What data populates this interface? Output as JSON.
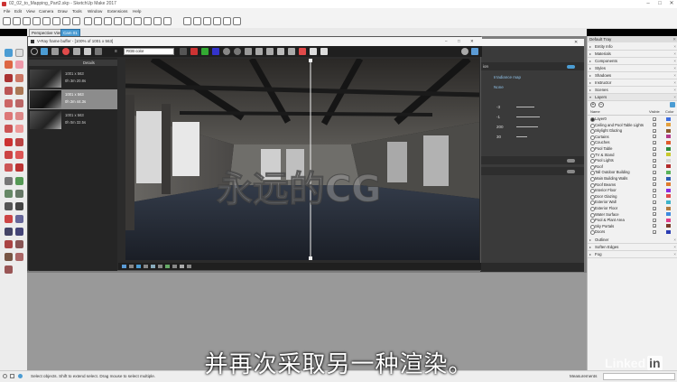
{
  "window": {
    "title": "02_02_to_Mapping_Part2.skp - SketchUp Make 2017",
    "minimize": "–",
    "maximize": "□",
    "close": "✕"
  },
  "menu": [
    "File",
    "Edit",
    "View",
    "Camera",
    "Draw",
    "Tools",
    "Window",
    "Extensions",
    "Help"
  ],
  "scene_tabs": [
    {
      "label": "Perspective View",
      "active": false
    },
    {
      "label": "Cam 01",
      "active": true
    }
  ],
  "frame_buffer": {
    "title": "V-Ray frame buffer - [100% of 1001 x 563]",
    "channel": "RGB color",
    "details_label": "Details",
    "history": [
      {
        "size": "1001 x 563",
        "time": "0h 3m 20.8s",
        "selected": false
      },
      {
        "size": "1001 x 563",
        "time": "0h 2m 44.3s",
        "selected": true
      },
      {
        "size": "1001 x 563",
        "time": "0h 0m 32.5s",
        "selected": false
      }
    ]
  },
  "vray_panel": {
    "section": "ion",
    "gi_primary": "Irradiance map",
    "gi_secondary": "None",
    "values": [
      "-3",
      "-1",
      "200",
      "30"
    ]
  },
  "tray": {
    "title": "Default Tray",
    "sections": [
      "Entity Info",
      "Materials",
      "Components",
      "Styles",
      "Shadows",
      "Instructor",
      "Scenes"
    ],
    "layers_title": "Layers",
    "col_visible": "Visible",
    "col_color": "Color",
    "layers": [
      {
        "name": "Layer0",
        "visible": true,
        "color": "#3d6ee0"
      },
      {
        "name": "Ceiling and Pool Table Lights",
        "visible": true,
        "color": "#e4a03d"
      },
      {
        "name": "Skylight Glazing",
        "visible": true,
        "color": "#8a5a2b"
      },
      {
        "name": "Curtains",
        "visible": true,
        "color": "#b33a8a"
      },
      {
        "name": "Couches",
        "visible": true,
        "color": "#e05a2b"
      },
      {
        "name": "Pool Table",
        "visible": true,
        "color": "#2b8a3d"
      },
      {
        "name": "TV & Stand",
        "visible": true,
        "color": "#c9c92b"
      },
      {
        "name": "Pool Lights",
        "visible": true,
        "color": "#d4d4d4"
      },
      {
        "name": "Roof",
        "visible": true,
        "color": "#b32b2b"
      },
      {
        "name": "Tall Outdoor Building",
        "visible": true,
        "color": "#5ab35a"
      },
      {
        "name": "Main Building Walls",
        "visible": true,
        "color": "#2b5ab3"
      },
      {
        "name": "Roof Beams",
        "visible": true,
        "color": "#e07a2b"
      },
      {
        "name": "Interior Floor",
        "visible": true,
        "color": "#8a2be0"
      },
      {
        "name": "Door Glazing",
        "visible": false,
        "color": "#e04a4a"
      },
      {
        "name": "Exterior Wall",
        "visible": true,
        "color": "#3db3c9"
      },
      {
        "name": "Exterior Floor",
        "visible": true,
        "color": "#b37a3d"
      },
      {
        "name": "Water Surface",
        "visible": true,
        "color": "#3d8ae0"
      },
      {
        "name": "Pool & Plant Area",
        "visible": true,
        "color": "#e03d8a"
      },
      {
        "name": "Sky Portals",
        "visible": true,
        "color": "#7a3d2b"
      },
      {
        "name": "Doors",
        "visible": true,
        "color": "#2b3db3"
      }
    ],
    "bottom_sections": [
      "Outliner",
      "Soften Edges",
      "Fog"
    ]
  },
  "status": {
    "message": "Select objects. Shift to extend select. Drag mouse to select multiple.",
    "measurements_label": "Measurements"
  },
  "overlay": {
    "subtitle": "并再次采取另一种渲染。",
    "watermark": "永远的CG",
    "brand": "Linked",
    "brand_in": "in"
  }
}
